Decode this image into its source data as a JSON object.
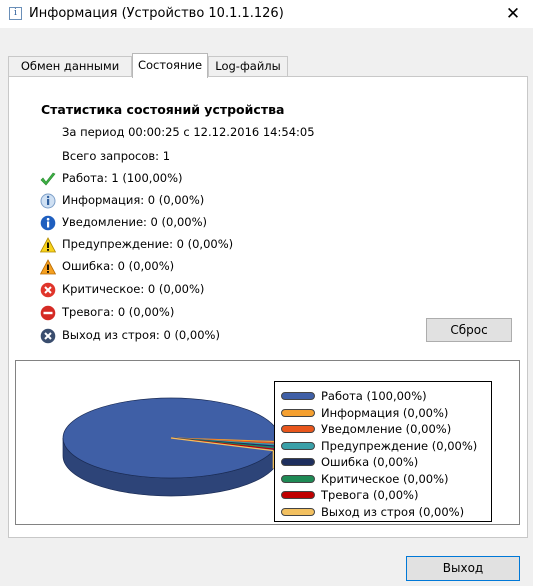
{
  "window": {
    "title": "Информация (Устройство 10.1.1.126)",
    "icon_text": "i",
    "close_glyph": "✕"
  },
  "tabs": [
    {
      "label": "Обмен данными",
      "active": false
    },
    {
      "label": "Состояние",
      "active": true
    },
    {
      "label": "Log-файлы",
      "active": false
    }
  ],
  "stats": {
    "heading": "Статистика состояний устройства",
    "period": "За период 00:00:25 с 12.12.2016 14:54:05",
    "total_requests": "Всего запросов: 1",
    "items": [
      {
        "icon": "check-icon",
        "label": "Работа: 1 (100,00%)"
      },
      {
        "icon": "info-shield-icon",
        "label": "Информация: 0 (0,00%)"
      },
      {
        "icon": "info-circle-icon",
        "label": "Уведомление: 0 (0,00%)"
      },
      {
        "icon": "warning-yellow-icon",
        "label": "Предупреждение: 0 (0,00%)"
      },
      {
        "icon": "warning-orange-icon",
        "label": "Ошибка: 0 (0,00%)"
      },
      {
        "icon": "critical-x-icon",
        "label": "Критическое: 0 (0,00%)"
      },
      {
        "icon": "alarm-minus-icon",
        "label": "Тревога: 0 (0,00%)"
      },
      {
        "icon": "failure-x-icon",
        "label": "Выход из строя: 0 (0,00%)"
      }
    ]
  },
  "buttons": {
    "reset": "Сброс",
    "exit": "Выход"
  },
  "chart_data": {
    "type": "pie",
    "categories": [
      "Работа",
      "Информация",
      "Уведомление",
      "Предупреждение",
      "Ошибка",
      "Критическое",
      "Тревога",
      "Выход из строя"
    ],
    "values": [
      1,
      0,
      0,
      0,
      0,
      0,
      0,
      0
    ],
    "legend_labels": [
      "Работа (100,00%)",
      "Информация (0,00%)",
      "Уведомление (0,00%)",
      "Предупреждение (0,00%)",
      "Ошибка (0,00%)",
      "Критическое (0,00%)",
      "Тревога (0,00%)",
      "Выход из строя (0,00%)"
    ],
    "colors": [
      "#3f5fa6",
      "#f5a030",
      "#e8561c",
      "#3aa0a8",
      "#1e2f5e",
      "#1f8a55",
      "#c00000",
      "#f2c060"
    ],
    "legend_position": "right",
    "style": "3d"
  }
}
